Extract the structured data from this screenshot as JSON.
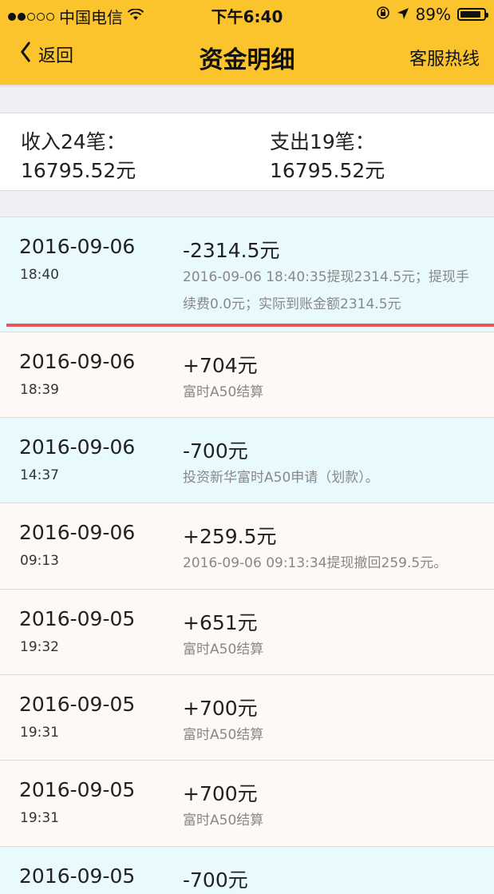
{
  "status_bar": {
    "carrier": "中国电信",
    "time": "下午6:40",
    "battery": "89%",
    "battery_level": 0.89
  },
  "nav": {
    "back_label": "返回",
    "title": "资金明细",
    "right_label": "客服热线"
  },
  "summary": {
    "income_label": "收入24笔：",
    "income_amount": "16795.52元",
    "expense_label": "支出19笔：",
    "expense_amount": "16795.52元"
  },
  "colors": {
    "header_bg": "#fcc42c",
    "expense_row_bg": "#e8fafe",
    "income_row_bg": "#fdf9f4",
    "highlight_line": "#e5595e"
  },
  "records": [
    {
      "date": "2016-09-06",
      "time": "18:40",
      "amount": "-2314.5元",
      "desc": "2016-09-06 18:40:35提现2314.5元；提现手续费0.0元；实际到账金额2314.5元",
      "type": "expense"
    },
    {
      "date": "2016-09-06",
      "time": "18:39",
      "amount": "+704元",
      "desc": "富时A50结算",
      "type": "income"
    },
    {
      "date": "2016-09-06",
      "time": "14:37",
      "amount": "-700元",
      "desc": "投资新华富时A50申请（划款）。",
      "type": "expense"
    },
    {
      "date": "2016-09-06",
      "time": "09:13",
      "amount": "+259.5元",
      "desc": "2016-09-06 09:13:34提现撤回259.5元。",
      "type": "income"
    },
    {
      "date": "2016-09-05",
      "time": "19:32",
      "amount": "+651元",
      "desc": "富时A50结算",
      "type": "income"
    },
    {
      "date": "2016-09-05",
      "time": "19:31",
      "amount": "+700元",
      "desc": "富时A50结算",
      "type": "income"
    },
    {
      "date": "2016-09-05",
      "time": "19:31",
      "amount": "+700元",
      "desc": "富时A50结算",
      "type": "income"
    },
    {
      "date": "2016-09-05",
      "time": "",
      "amount": "-700元",
      "desc": "",
      "type": "expense"
    }
  ]
}
